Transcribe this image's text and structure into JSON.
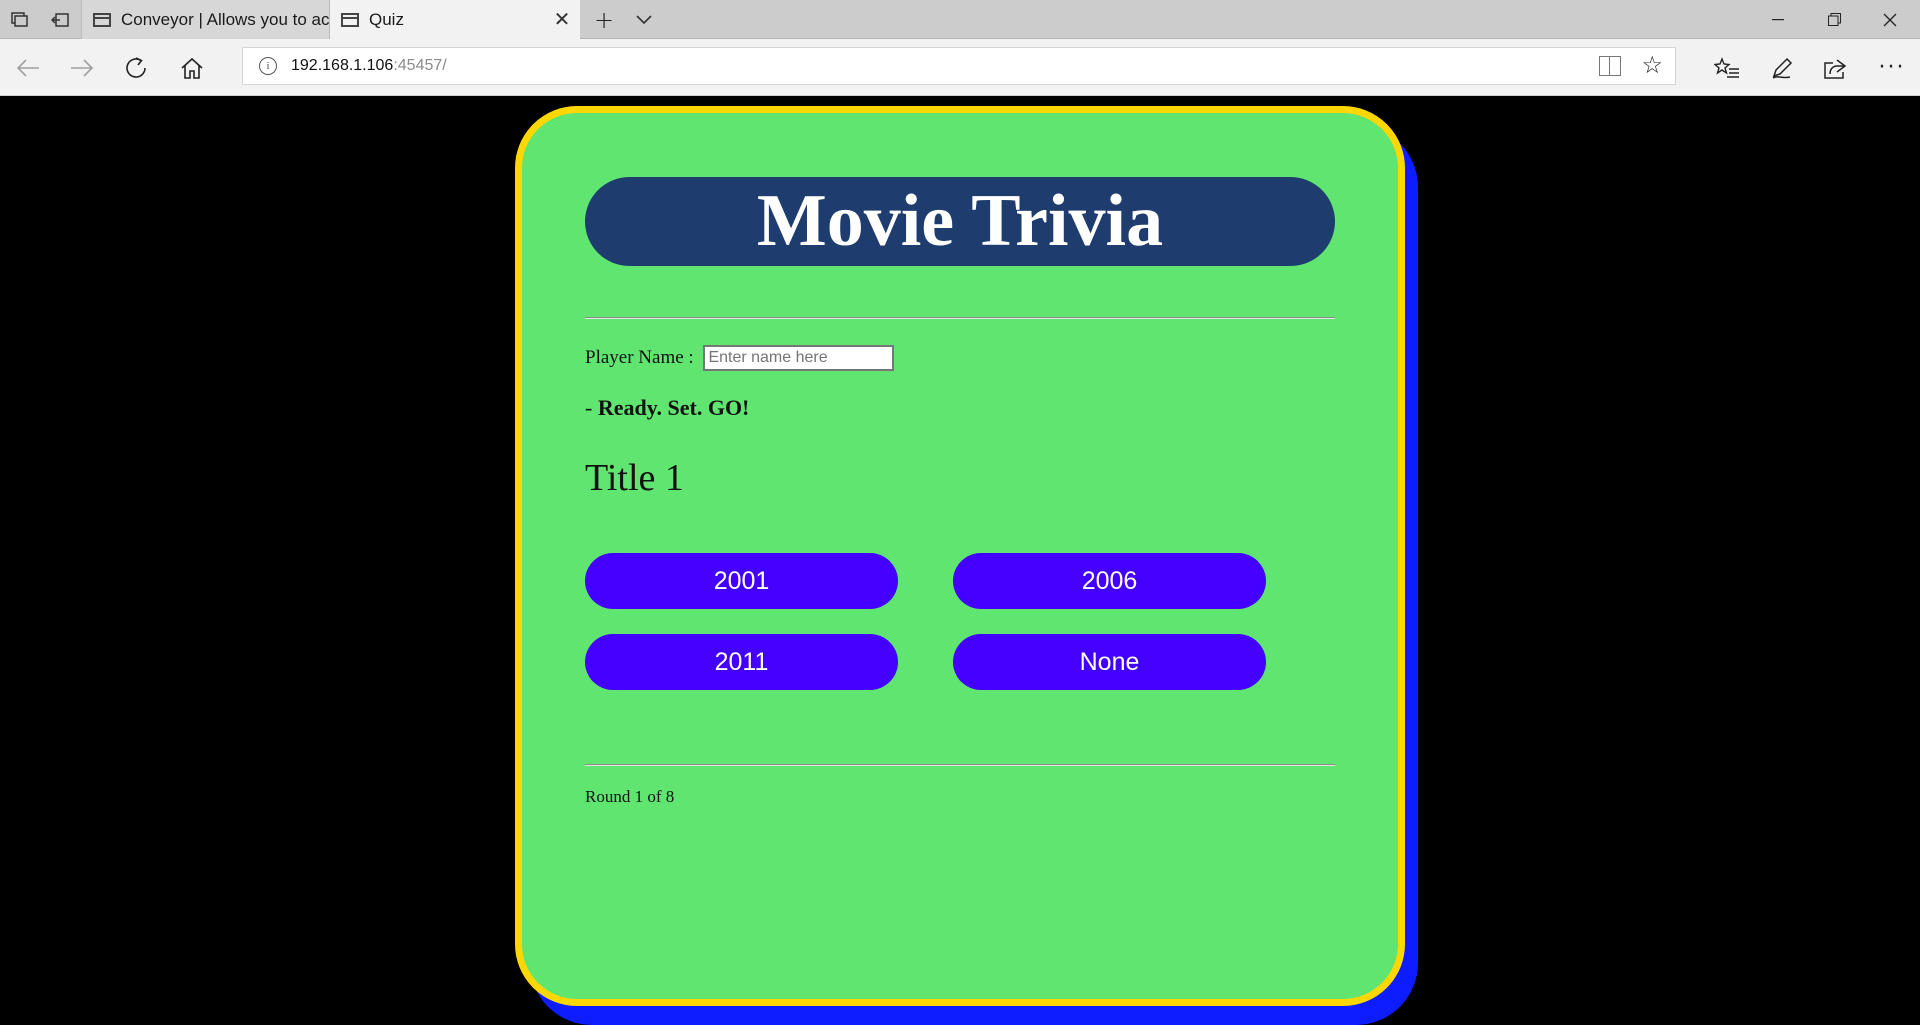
{
  "browser": {
    "tabs": [
      {
        "label": "Conveyor | Allows you to ac",
        "active": false
      },
      {
        "label": "Quiz",
        "active": true
      }
    ],
    "address": {
      "host": "192.168.1.106",
      "path": ":45457/"
    },
    "icons": {
      "tab_switcher": "tab-switcher-icon",
      "set_aside": "set-aside-tabs-icon",
      "new_tab": "plus-icon",
      "tab_menu": "chevron-down-icon",
      "back": "back-arrow-icon",
      "forward": "forward-arrow-icon",
      "refresh": "refresh-icon",
      "home": "home-icon",
      "info": "info-icon",
      "reading_view": "reading-view-icon",
      "favorite": "star-icon",
      "favorites_hub": "favorites-list-icon",
      "notes": "pen-icon",
      "share": "share-icon",
      "more": "more-icon",
      "minimize": "minimize-icon",
      "restore": "restore-icon",
      "close": "close-icon"
    }
  },
  "quiz": {
    "title": "Movie Trivia",
    "player_label": "Player Name : ",
    "player_placeholder": "Enter name here",
    "player_value": "",
    "status_prefix": "- ",
    "status_text": "Ready. Set. GO!",
    "question": "Title 1",
    "answers": [
      "2001",
      "2006",
      "2011",
      "None"
    ],
    "round": "Round 1 of 8"
  },
  "colors": {
    "page_bg": "#000000",
    "card_bg": "#5fe570",
    "card_border": "#ffd700",
    "card_shadow": "#0d1dff",
    "title_bg": "#1e3d6e",
    "answer_bg": "#4400ff"
  }
}
